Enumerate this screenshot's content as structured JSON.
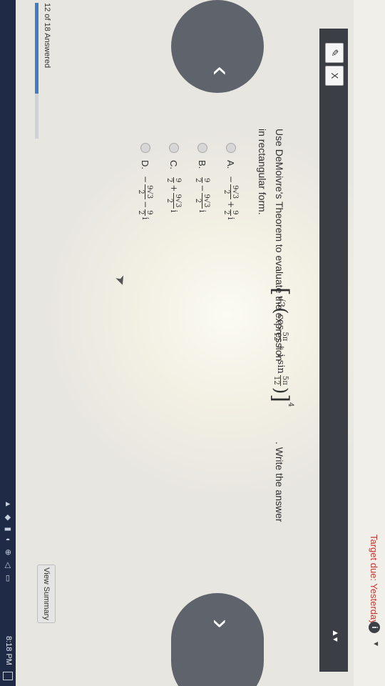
{
  "header": {
    "target_due": "Target due: Yesterday",
    "info_icon": "info-icon",
    "caret_icon": "caret-down-icon"
  },
  "toolbar": {
    "tools": [
      "pencil-icon",
      "close-icon"
    ],
    "close_glyph": "X"
  },
  "question": {
    "prompt_start": "Use DeMoivre's Theorem to evaluate the expression",
    "prompt_end": ". Write the answer",
    "prompt_line2": "in rectangular form.",
    "expression": {
      "radical": "√3",
      "cos": "cos",
      "sin": "+ i sin",
      "angle_num": "5π",
      "angle_den": "12",
      "exponent": "4"
    }
  },
  "options": [
    {
      "letter": "A.",
      "sign": "−",
      "t1_num": "9√3",
      "t1_den": "2",
      "op": "+",
      "t2_num": "9",
      "t2_den": "2",
      "tail": "i"
    },
    {
      "letter": "B.",
      "sign": "",
      "t1_num": "9",
      "t1_den": "2",
      "op": "−",
      "t2_num": "9√3",
      "t2_den": "2",
      "tail": "i"
    },
    {
      "letter": "C.",
      "sign": "",
      "t1_num": "9",
      "t1_den": "2",
      "op": "+",
      "t2_num": "9√3",
      "t2_den": "2",
      "tail": "i"
    },
    {
      "letter": "D.",
      "sign": "−",
      "t1_num": "9√3",
      "t1_den": "2",
      "op": "−",
      "t2_num": "9",
      "t2_den": "2",
      "tail": "i"
    }
  ],
  "footer": {
    "answered_text": "12 of 18 Answered",
    "progress_fraction": 0.667,
    "view_summary_label": "View Summary"
  },
  "taskbar": {
    "clock": "8:18 PM"
  },
  "colors": {
    "accent_red": "#c4372f",
    "toolbar_dark": "#3b3f45",
    "nav_circle": "#5f636b",
    "progress_blue": "#3f7fc1",
    "taskbar": "#1f2b46"
  }
}
